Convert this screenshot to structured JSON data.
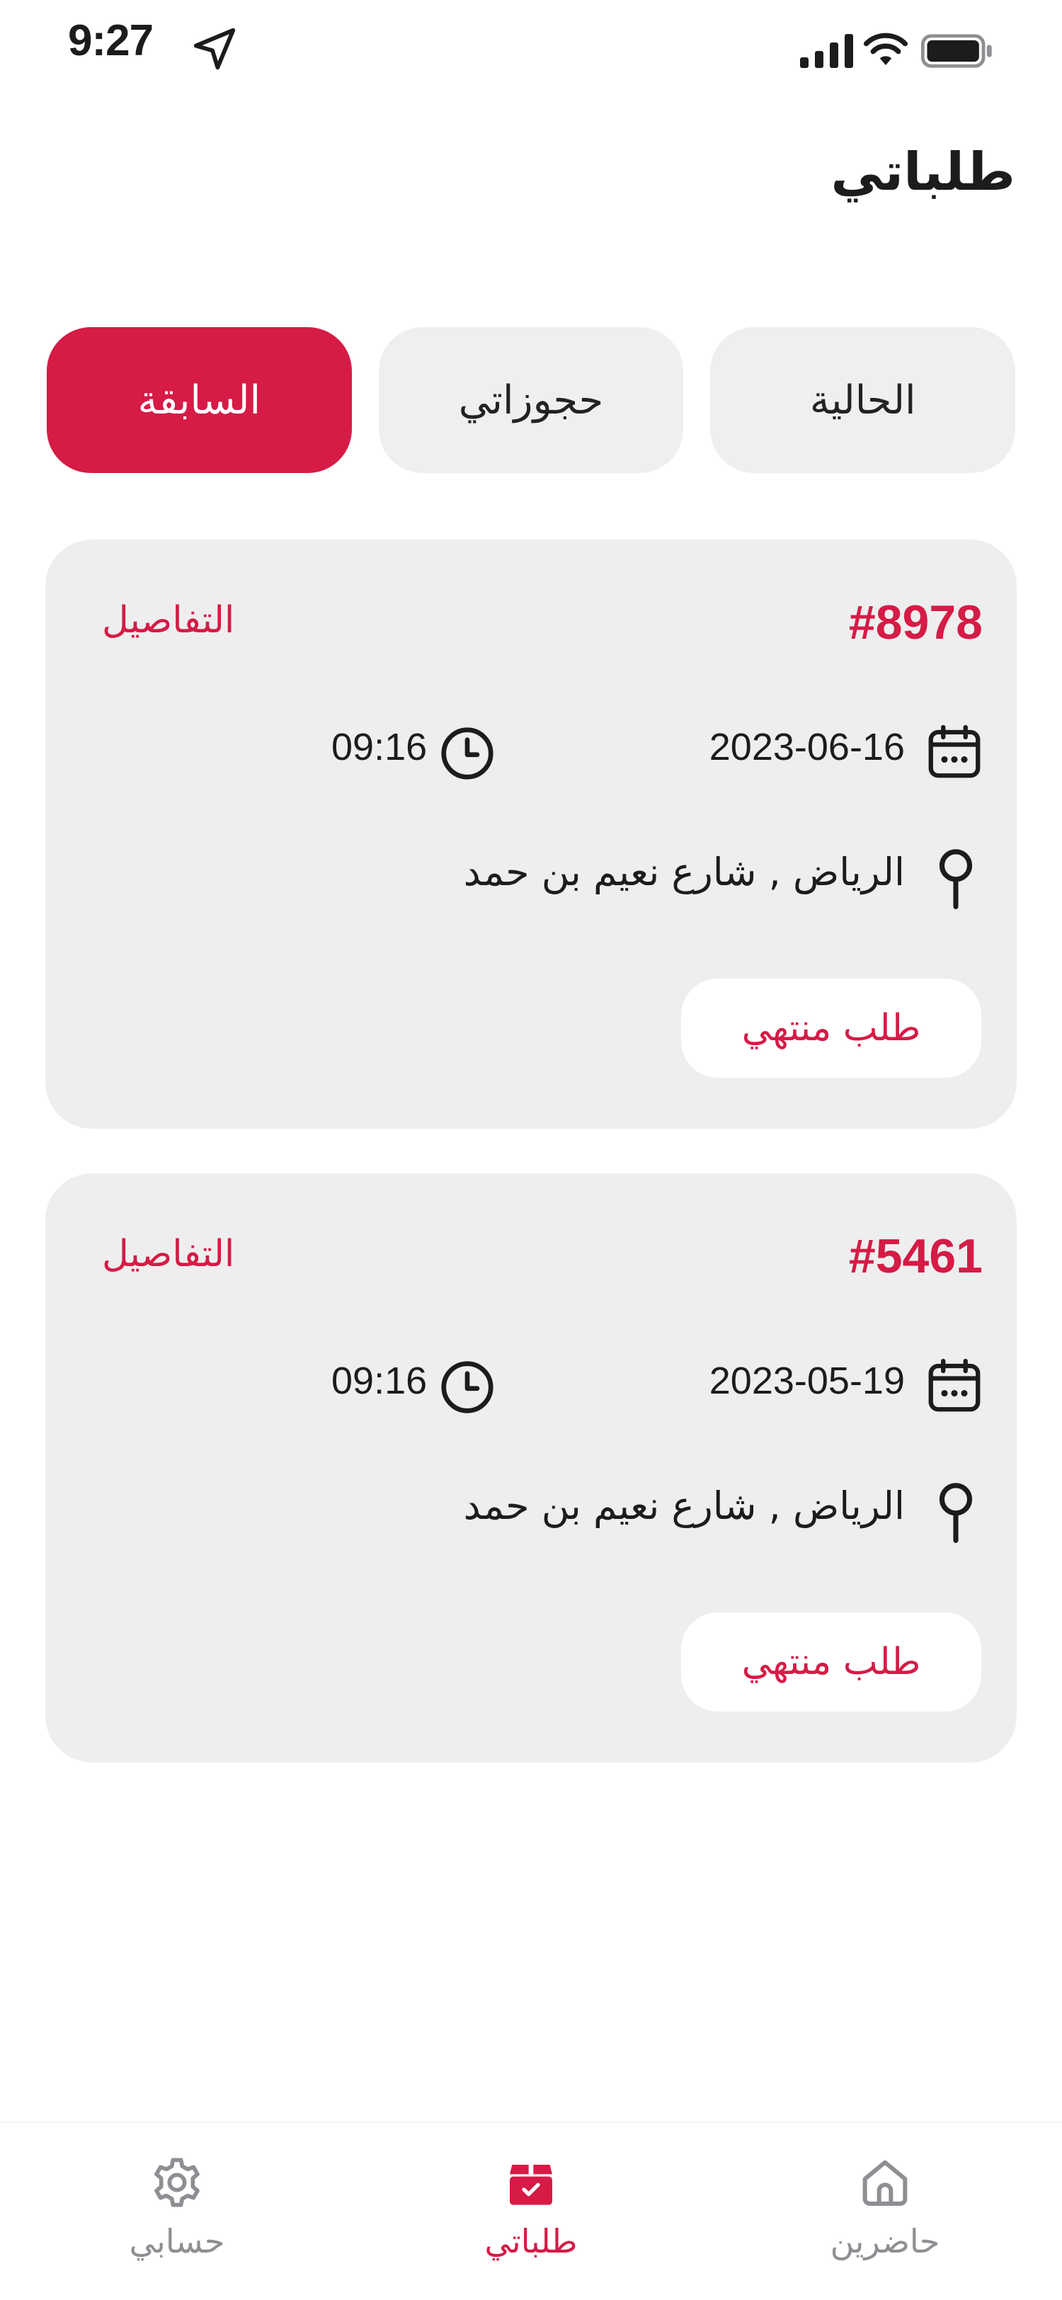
{
  "status_bar": {
    "time": "9:27"
  },
  "header": {
    "title": "طلباتي"
  },
  "tabs": [
    {
      "label": "الحالية",
      "active": false
    },
    {
      "label": "حجوزاتي",
      "active": false
    },
    {
      "label": "السابقة",
      "active": true
    }
  ],
  "orders": [
    {
      "number": "#8978",
      "details_label": "التفاصيل",
      "date": "2023-06-16",
      "time": "09:16",
      "address": "الرياض , شارع نعيم بن حمد",
      "status": "طلب منتهي"
    },
    {
      "number": "#5461",
      "details_label": "التفاصيل",
      "date": "2023-05-19",
      "time": "09:16",
      "address": "الرياض , شارع نعيم بن حمد",
      "status": "طلب منتهي"
    }
  ],
  "bottom_nav": [
    {
      "label": "حاضرين",
      "icon": "home-icon",
      "active": false
    },
    {
      "label": "طلباتي",
      "icon": "orders-box-icon",
      "active": true
    },
    {
      "label": "حسابي",
      "icon": "gear-icon",
      "active": false
    }
  ],
  "colors": {
    "accent": "#d51b46",
    "card_bg": "#eeeeee",
    "tab_bg": "#efefef",
    "inactive_nav": "#8e8e93"
  }
}
